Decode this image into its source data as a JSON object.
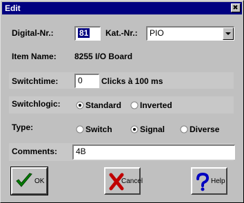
{
  "window": {
    "title": "Edit"
  },
  "form": {
    "digital_nr": {
      "label": "Digital-Nr.:",
      "value": "81"
    },
    "kat_nr": {
      "label": "Kat.-Nr.:",
      "value": "PIO"
    },
    "item_name": {
      "label": "Item Name:",
      "value": "8255 I/O Board"
    },
    "switchtime": {
      "label": "Switchtime:",
      "value": "0",
      "unit": "Clicks à 100 ms"
    },
    "switchlogic": {
      "label": "Switchlogic:",
      "options": [
        "Standard",
        "Inverted"
      ],
      "selected": "Standard"
    },
    "type": {
      "label": "Type:",
      "options": [
        "Switch",
        "Signal",
        "Diverse"
      ],
      "selected": "Signal"
    },
    "comments": {
      "label": "Comments:",
      "value": "4B"
    }
  },
  "buttons": {
    "ok": "OK",
    "cancel": "Cancel",
    "help": "Help"
  },
  "icons": {
    "ok": "checkmark-icon",
    "cancel": "red-x-icon",
    "help": "question-mark-icon",
    "close": "close-icon"
  },
  "colors": {
    "titlebar": "#000080",
    "ok_check": "#008000",
    "cancel_x": "#c00000",
    "help_q": "#0000c0"
  }
}
